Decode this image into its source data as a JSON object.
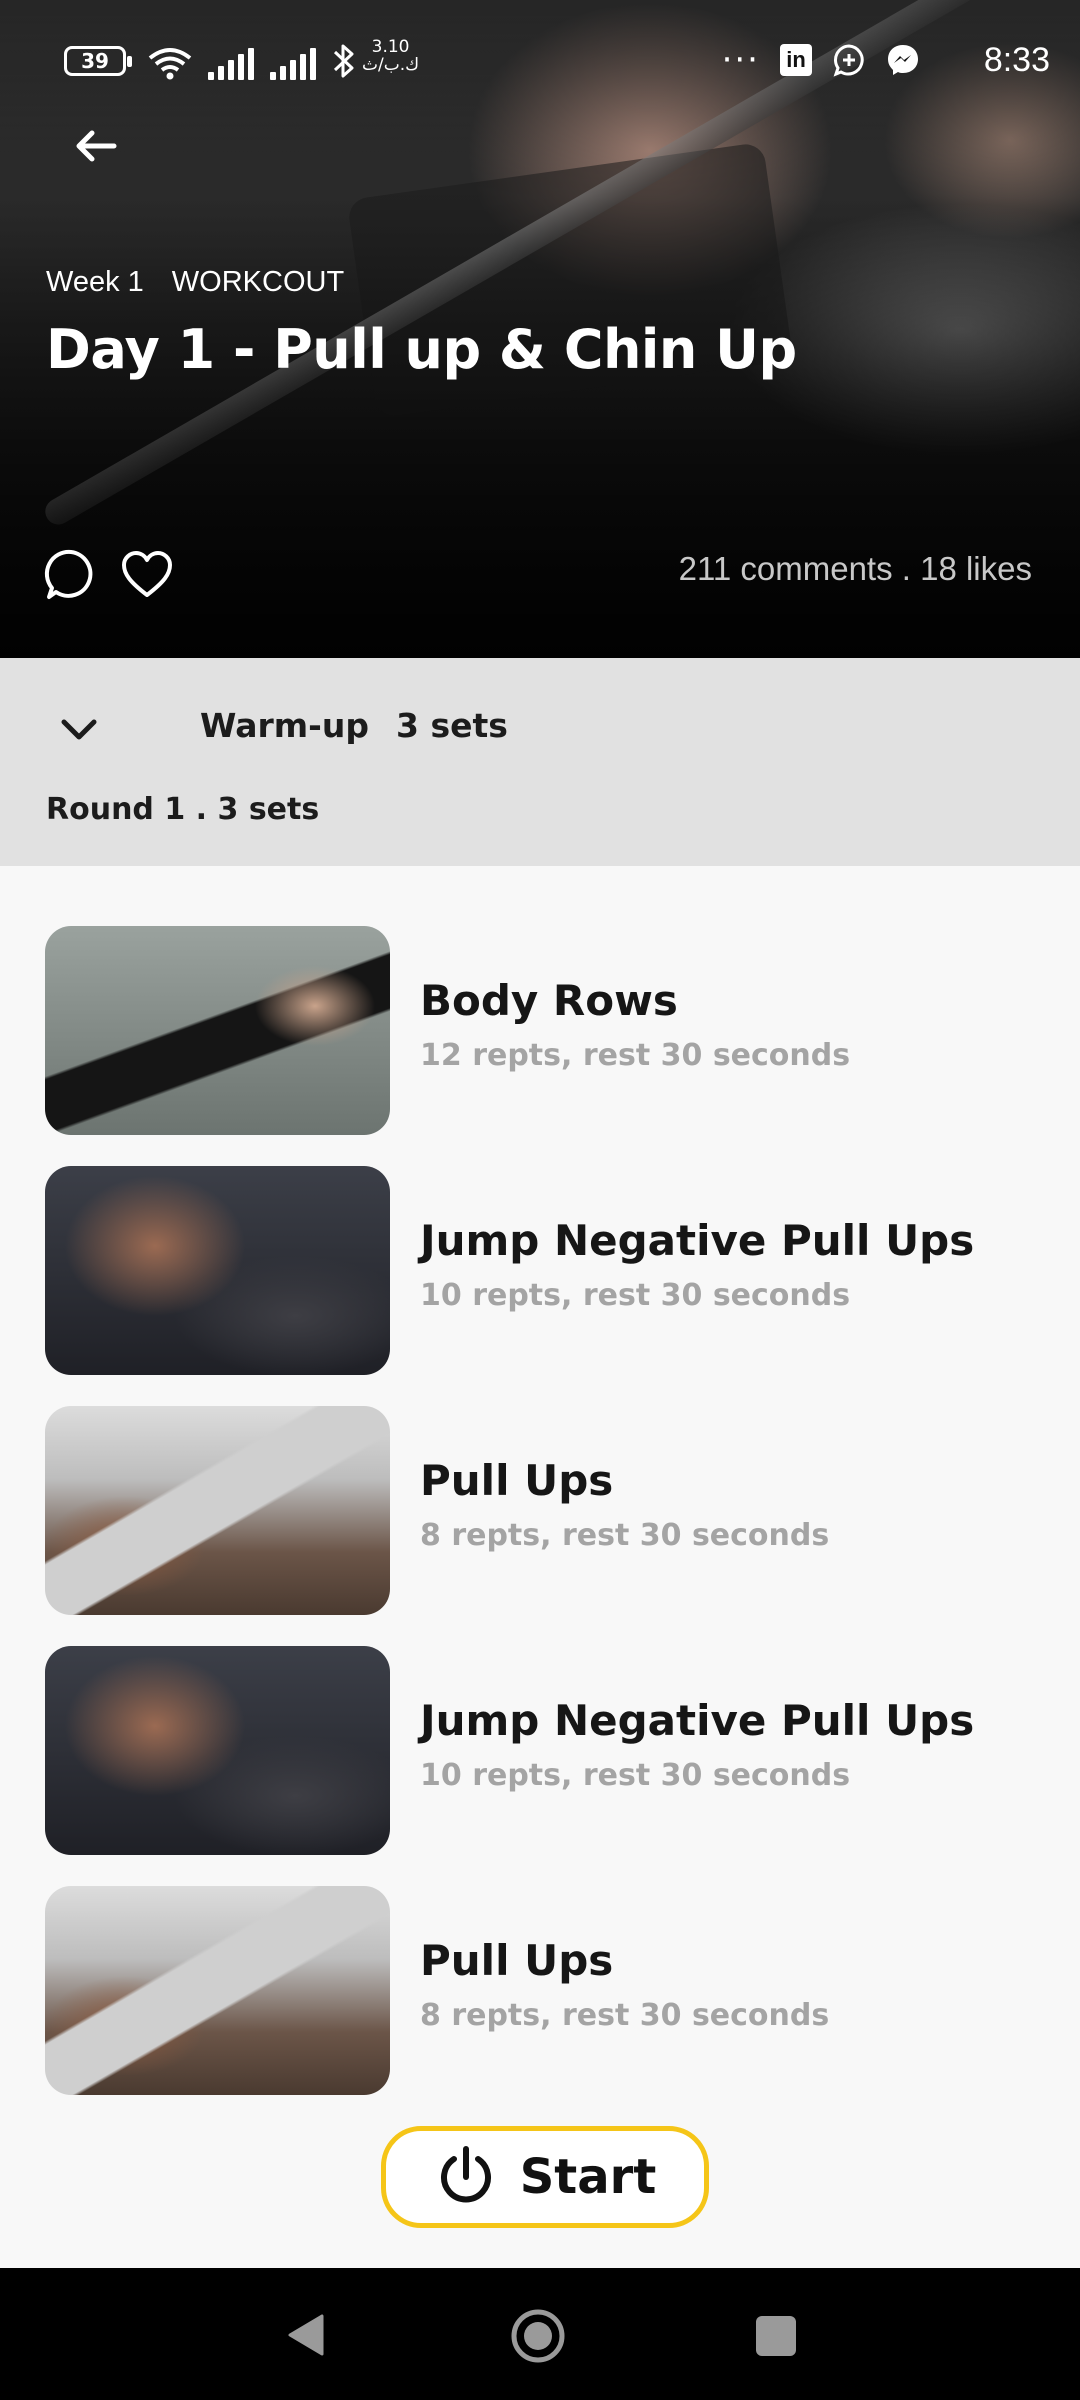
{
  "status_bar": {
    "battery": "39",
    "network_speed_value": "3.10",
    "network_speed_unit": "ك.ب/ث",
    "time": "8:33",
    "icons": [
      "wifi-icon",
      "signal-icon",
      "signal-icon",
      "bluetooth-icon",
      "more-icon",
      "linkedin-icon",
      "add-chat-icon",
      "messenger-icon"
    ]
  },
  "hero": {
    "week": "Week 1",
    "category": "WORKCOUT",
    "title": "Day 1 - Pull up & Chin Up",
    "stats": "211 comments . 18 likes"
  },
  "section": {
    "name": "Warm-up",
    "sets": "3 sets",
    "round": "Round 1 . 3 sets"
  },
  "exercises": [
    {
      "name": "Body Rows",
      "detail": "12 repts, rest 30 seconds"
    },
    {
      "name": "Jump Negative Pull Ups",
      "detail": "10 repts, rest 30 seconds"
    },
    {
      "name": "Pull Ups",
      "detail": "8 repts, rest 30 seconds"
    },
    {
      "name": "Jump Negative Pull Ups",
      "detail": "10 repts, rest 30 seconds"
    },
    {
      "name": "Pull Ups",
      "detail": "8 repts, rest 30 seconds"
    }
  ],
  "start_button": {
    "label": "Start"
  },
  "colors": {
    "accent": "#f5c518",
    "section_bg": "#e1e1e1",
    "page_bg": "#f8f8f8",
    "muted_text": "#a4a4a4"
  }
}
